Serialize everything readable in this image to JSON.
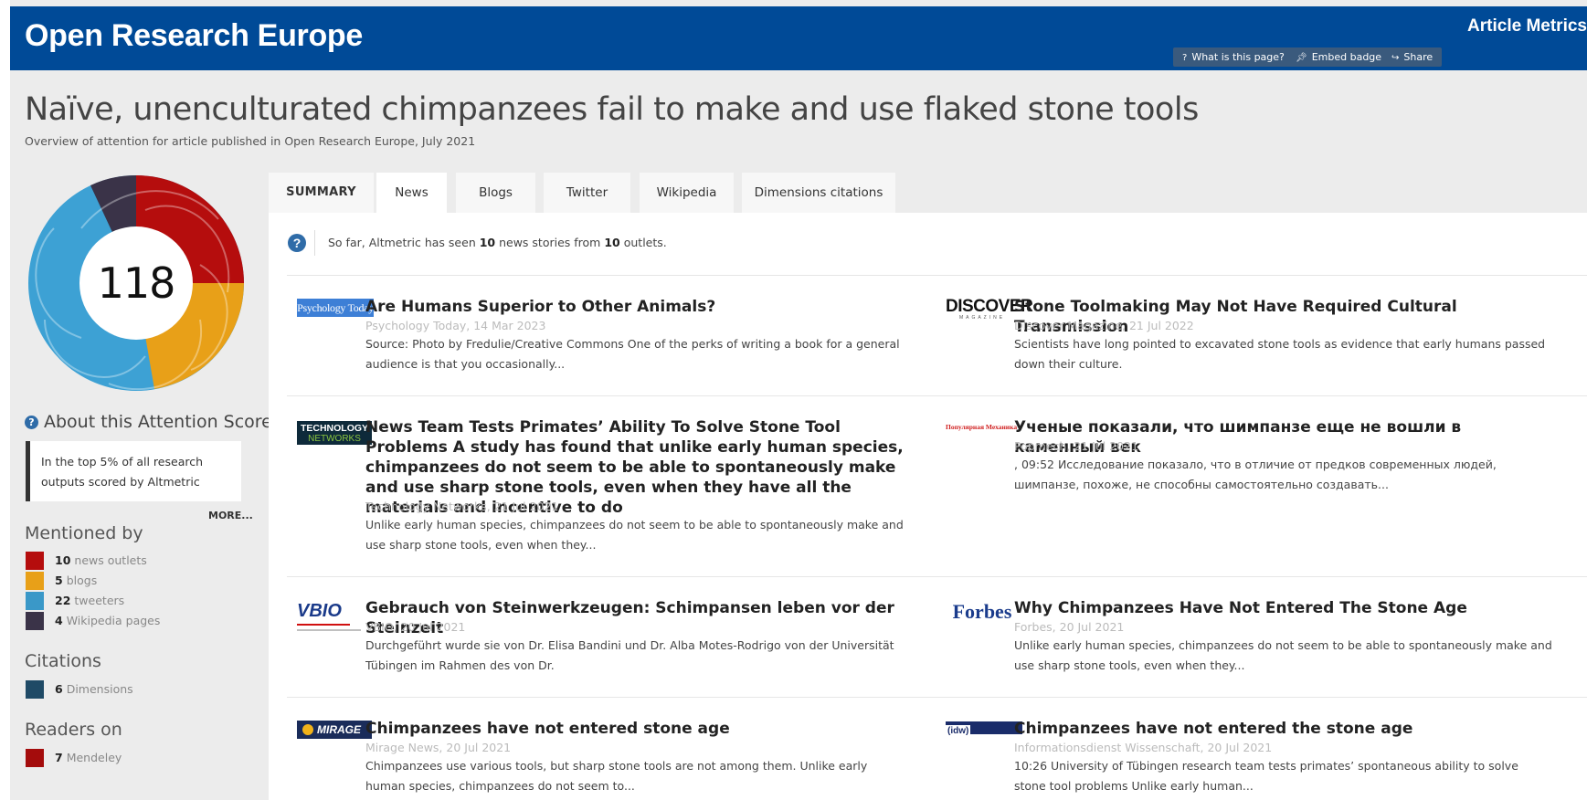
{
  "header": {
    "brand": "Open Research Europe",
    "section_title": "Article Metrics",
    "buttons": [
      {
        "icon": "question-icon",
        "label": "What is this page?"
      },
      {
        "icon": "pin-icon",
        "label": "Embed badge"
      },
      {
        "icon": "share-icon",
        "label": "Share"
      }
    ]
  },
  "article": {
    "title": "Naïve, unenculturated chimpanzees fail to make and use flaked stone tools",
    "subtitle": "Overview of attention for article published in Open Research Europe, July 2021"
  },
  "score": {
    "value": "118",
    "donut_colors": [
      "#b50d0d",
      "#e8a018",
      "#3da1d4",
      "#3a3348"
    ]
  },
  "sidebar": {
    "about_heading": "About this Attention Score",
    "top_box_text": "In the top 5% of all research outputs scored by Altmetric",
    "more_label": "MORE...",
    "mentioned_heading": "Mentioned by",
    "mentioned": [
      {
        "count": "10",
        "label": "news outlets",
        "color": "#b50d0d"
      },
      {
        "count": "5",
        "label": "blogs",
        "color": "#e8a018"
      },
      {
        "count": "22",
        "label": "tweeters",
        "color": "#3a98c8"
      },
      {
        "count": "4",
        "label": "Wikipedia pages",
        "color": "#3a3348"
      }
    ],
    "citations_heading": "Citations",
    "citations": [
      {
        "count": "6",
        "label": "Dimensions",
        "color": "#1f4a66"
      }
    ],
    "readers_heading": "Readers on",
    "readers": [
      {
        "count": "7",
        "label": "Mendeley",
        "color": "#a40c0c"
      }
    ]
  },
  "tabs": [
    "SUMMARY",
    "News",
    "Blogs",
    "Twitter",
    "Wikipedia",
    "Dimensions citations"
  ],
  "info": {
    "prefix": "So far, Altmetric has seen ",
    "stories": "10",
    "middle": " news stories from ",
    "outlets": "10",
    "suffix": " outlets."
  },
  "stories": [
    {
      "logo": "Psychology Today",
      "title": "Are Humans Superior to Other Animals?",
      "meta": "Psychology Today, 14 Mar 2023",
      "body": "Source: Photo by Fredulie/Creative Commons One of the perks of writing a book for a general audience is that you occasionally..."
    },
    {
      "logo": "DISCOVER",
      "logo_sub": "MAGAZINE",
      "title": "Stone Toolmaking May Not Have Required Cultural Transmission",
      "meta": "Discover Magazine, 21 Jul 2022",
      "body": "Scientists have long pointed to excavated stone tools as evidence that early humans passed down their culture."
    },
    {
      "logo": "TECHNOLOGY",
      "logo_sub": "NETWORKS",
      "title": "News Team Tests Primates’ Ability To Solve Stone Tool Problems A study has found that unlike early human species, chimpanzees do not seem to be able to spontaneously make and use sharp stone tools, even when they have all the materials and incentive to do",
      "meta": "Technology Networks, 21 Jul 2021",
      "body": "Unlike early human species, chimpanzees do not seem to be able to spontaneously make and use sharp stone tools, even when they..."
    },
    {
      "logo": "Популярная Механика",
      "title": "Ученые показали, что шимпанзе еще не вошли в каменный век",
      "meta": "Popmech, 21 Jul 2021",
      "body": ", 09:52 Исследование показало, что в отличие от предков современных людей, шимпанзе, похоже, не способны самостоятельно создавать..."
    },
    {
      "logo": "VBIO",
      "title": "Gebrauch von Steinwerkzeugen: Schimpansen leben vor der Steinzeit",
      "meta": "VBIO, 20 Jul 2021",
      "body": "Durchgeführt wurde sie von Dr. Elisa Bandini und Dr. Alba Motes-Rodrigo von der Universität Tübingen im Rahmen des von Dr."
    },
    {
      "logo": "Forbes",
      "title": "Why Chimpanzees Have Not Entered The Stone Age",
      "meta": "Forbes, 20 Jul 2021",
      "body": "Unlike early human species, chimpanzees do not seem to be able to spontaneously make and use sharp stone tools, even when they..."
    },
    {
      "logo": "MIRAGE",
      "title": "Chimpanzees have not entered stone age",
      "meta": "Mirage News, 20 Jul 2021",
      "body": "Chimpanzees use various tools, but sharp stone tools are not among them. Unlike early human species, chimpanzees do not seem to..."
    },
    {
      "logo": "(idw)",
      "title": "Chimpanzees have not entered the stone age",
      "meta": "Informationsdienst Wissenschaft, 20 Jul 2021",
      "body": "10:26 University of Tübingen research team tests primates’ spontaneous ability to solve stone tool problems Unlike early human..."
    }
  ]
}
